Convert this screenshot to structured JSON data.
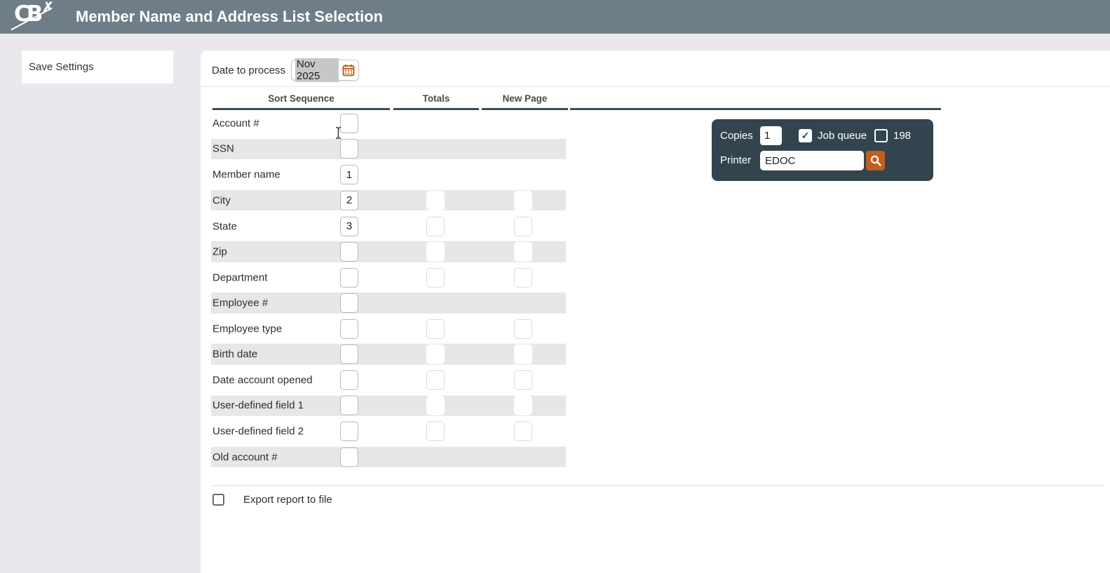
{
  "header": {
    "logo_text": "CB",
    "logo_x": "✗",
    "title": "Member Name and Address List Selection"
  },
  "sidebar": {
    "save_settings_label": "Save Settings"
  },
  "form": {
    "date_label": "Date to process",
    "date_value": "Nov 2025",
    "columns": {
      "sort": "Sort Sequence",
      "totals": "Totals",
      "newpage": "New Page"
    },
    "rows": [
      {
        "label": "Account #",
        "sort": "",
        "totals": false,
        "newpage": false
      },
      {
        "label": "SSN",
        "sort": "",
        "totals": false,
        "newpage": false
      },
      {
        "label": "Member name",
        "sort": "1",
        "totals": false,
        "newpage": false
      },
      {
        "label": "City",
        "sort": "2",
        "totals": true,
        "newpage": true
      },
      {
        "label": "State",
        "sort": "3",
        "totals": true,
        "newpage": true
      },
      {
        "label": "Zip",
        "sort": "",
        "totals": true,
        "newpage": true
      },
      {
        "label": "Department",
        "sort": "",
        "totals": true,
        "newpage": true
      },
      {
        "label": "Employee #",
        "sort": "",
        "totals": false,
        "newpage": false
      },
      {
        "label": "Employee type",
        "sort": "",
        "totals": true,
        "newpage": true
      },
      {
        "label": "Birth date",
        "sort": "",
        "totals": true,
        "newpage": true
      },
      {
        "label": "Date account opened",
        "sort": "",
        "totals": true,
        "newpage": true
      },
      {
        "label": "User-defined field 1",
        "sort": "",
        "totals": true,
        "newpage": true
      },
      {
        "label": "User-defined field 2",
        "sort": "",
        "totals": true,
        "newpage": true
      },
      {
        "label": "Old account #",
        "sort": "",
        "totals": false,
        "newpage": false
      }
    ],
    "export_label": "Export report to file",
    "export_checked": false
  },
  "print_panel": {
    "copies_label": "Copies",
    "copies_value": "1",
    "job_queue_label": "Job queue",
    "job_queue_checked": true,
    "checkmark": "✓",
    "station_label": "198",
    "station_checked": false,
    "printer_label": "Printer",
    "printer_value": "EDOC"
  },
  "colors": {
    "header_bg": "#6e7d86",
    "page_bg": "#e9e9ed",
    "stripe": "#e7e7e7",
    "panel_bg": "#33444e",
    "accent_orange": "#c05f1e",
    "rule_dark": "#3d4d56"
  }
}
